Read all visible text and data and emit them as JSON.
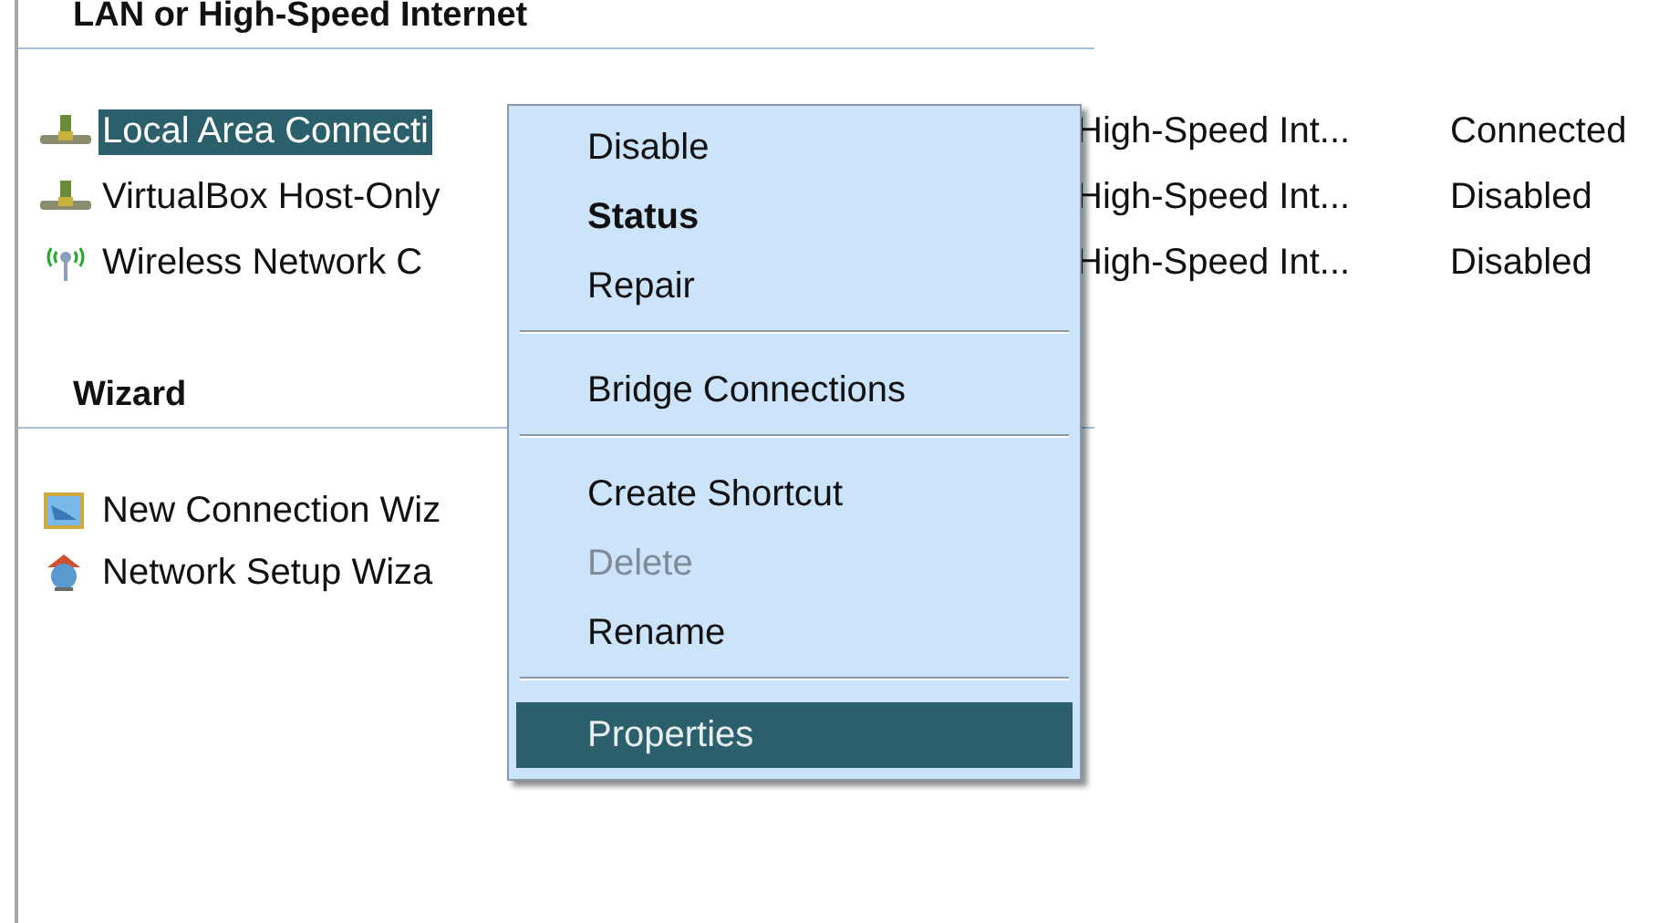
{
  "sections": [
    {
      "title": "LAN or High-Speed Internet",
      "items": [
        {
          "kind": "wired",
          "name": "Local Area Connecti",
          "type": "High-Speed Int...",
          "status": "Connected",
          "selected": true
        },
        {
          "kind": "wired",
          "name": "VirtualBox Host-Only",
          "type": "High-Speed Int...",
          "status": "Disabled",
          "selected": false
        },
        {
          "kind": "wireless",
          "name": "Wireless Network C",
          "type": "High-Speed Int...",
          "status": "Disabled",
          "selected": false
        }
      ]
    },
    {
      "title": "Wizard",
      "items": [
        {
          "kind": "new-wizard",
          "name": "New Connection Wiz",
          "selected": false
        },
        {
          "kind": "setup-wizard",
          "name": "Network Setup Wiza",
          "selected": false
        }
      ]
    }
  ],
  "context_menu": [
    {
      "kind": "item",
      "label": "Disable",
      "default": false,
      "disabled": false,
      "selected": false
    },
    {
      "kind": "item",
      "label": "Status",
      "default": true,
      "disabled": false,
      "selected": false
    },
    {
      "kind": "item",
      "label": "Repair",
      "default": false,
      "disabled": false,
      "selected": false
    },
    {
      "kind": "separator"
    },
    {
      "kind": "item",
      "label": "Bridge Connections",
      "default": false,
      "disabled": false,
      "selected": false
    },
    {
      "kind": "separator"
    },
    {
      "kind": "item",
      "label": "Create Shortcut",
      "default": false,
      "disabled": false,
      "selected": false
    },
    {
      "kind": "item",
      "label": "Delete",
      "default": false,
      "disabled": true,
      "selected": false
    },
    {
      "kind": "item",
      "label": "Rename",
      "default": false,
      "disabled": false,
      "selected": false
    },
    {
      "kind": "separator"
    },
    {
      "kind": "item",
      "label": "Properties",
      "default": false,
      "disabled": false,
      "selected": true
    }
  ]
}
